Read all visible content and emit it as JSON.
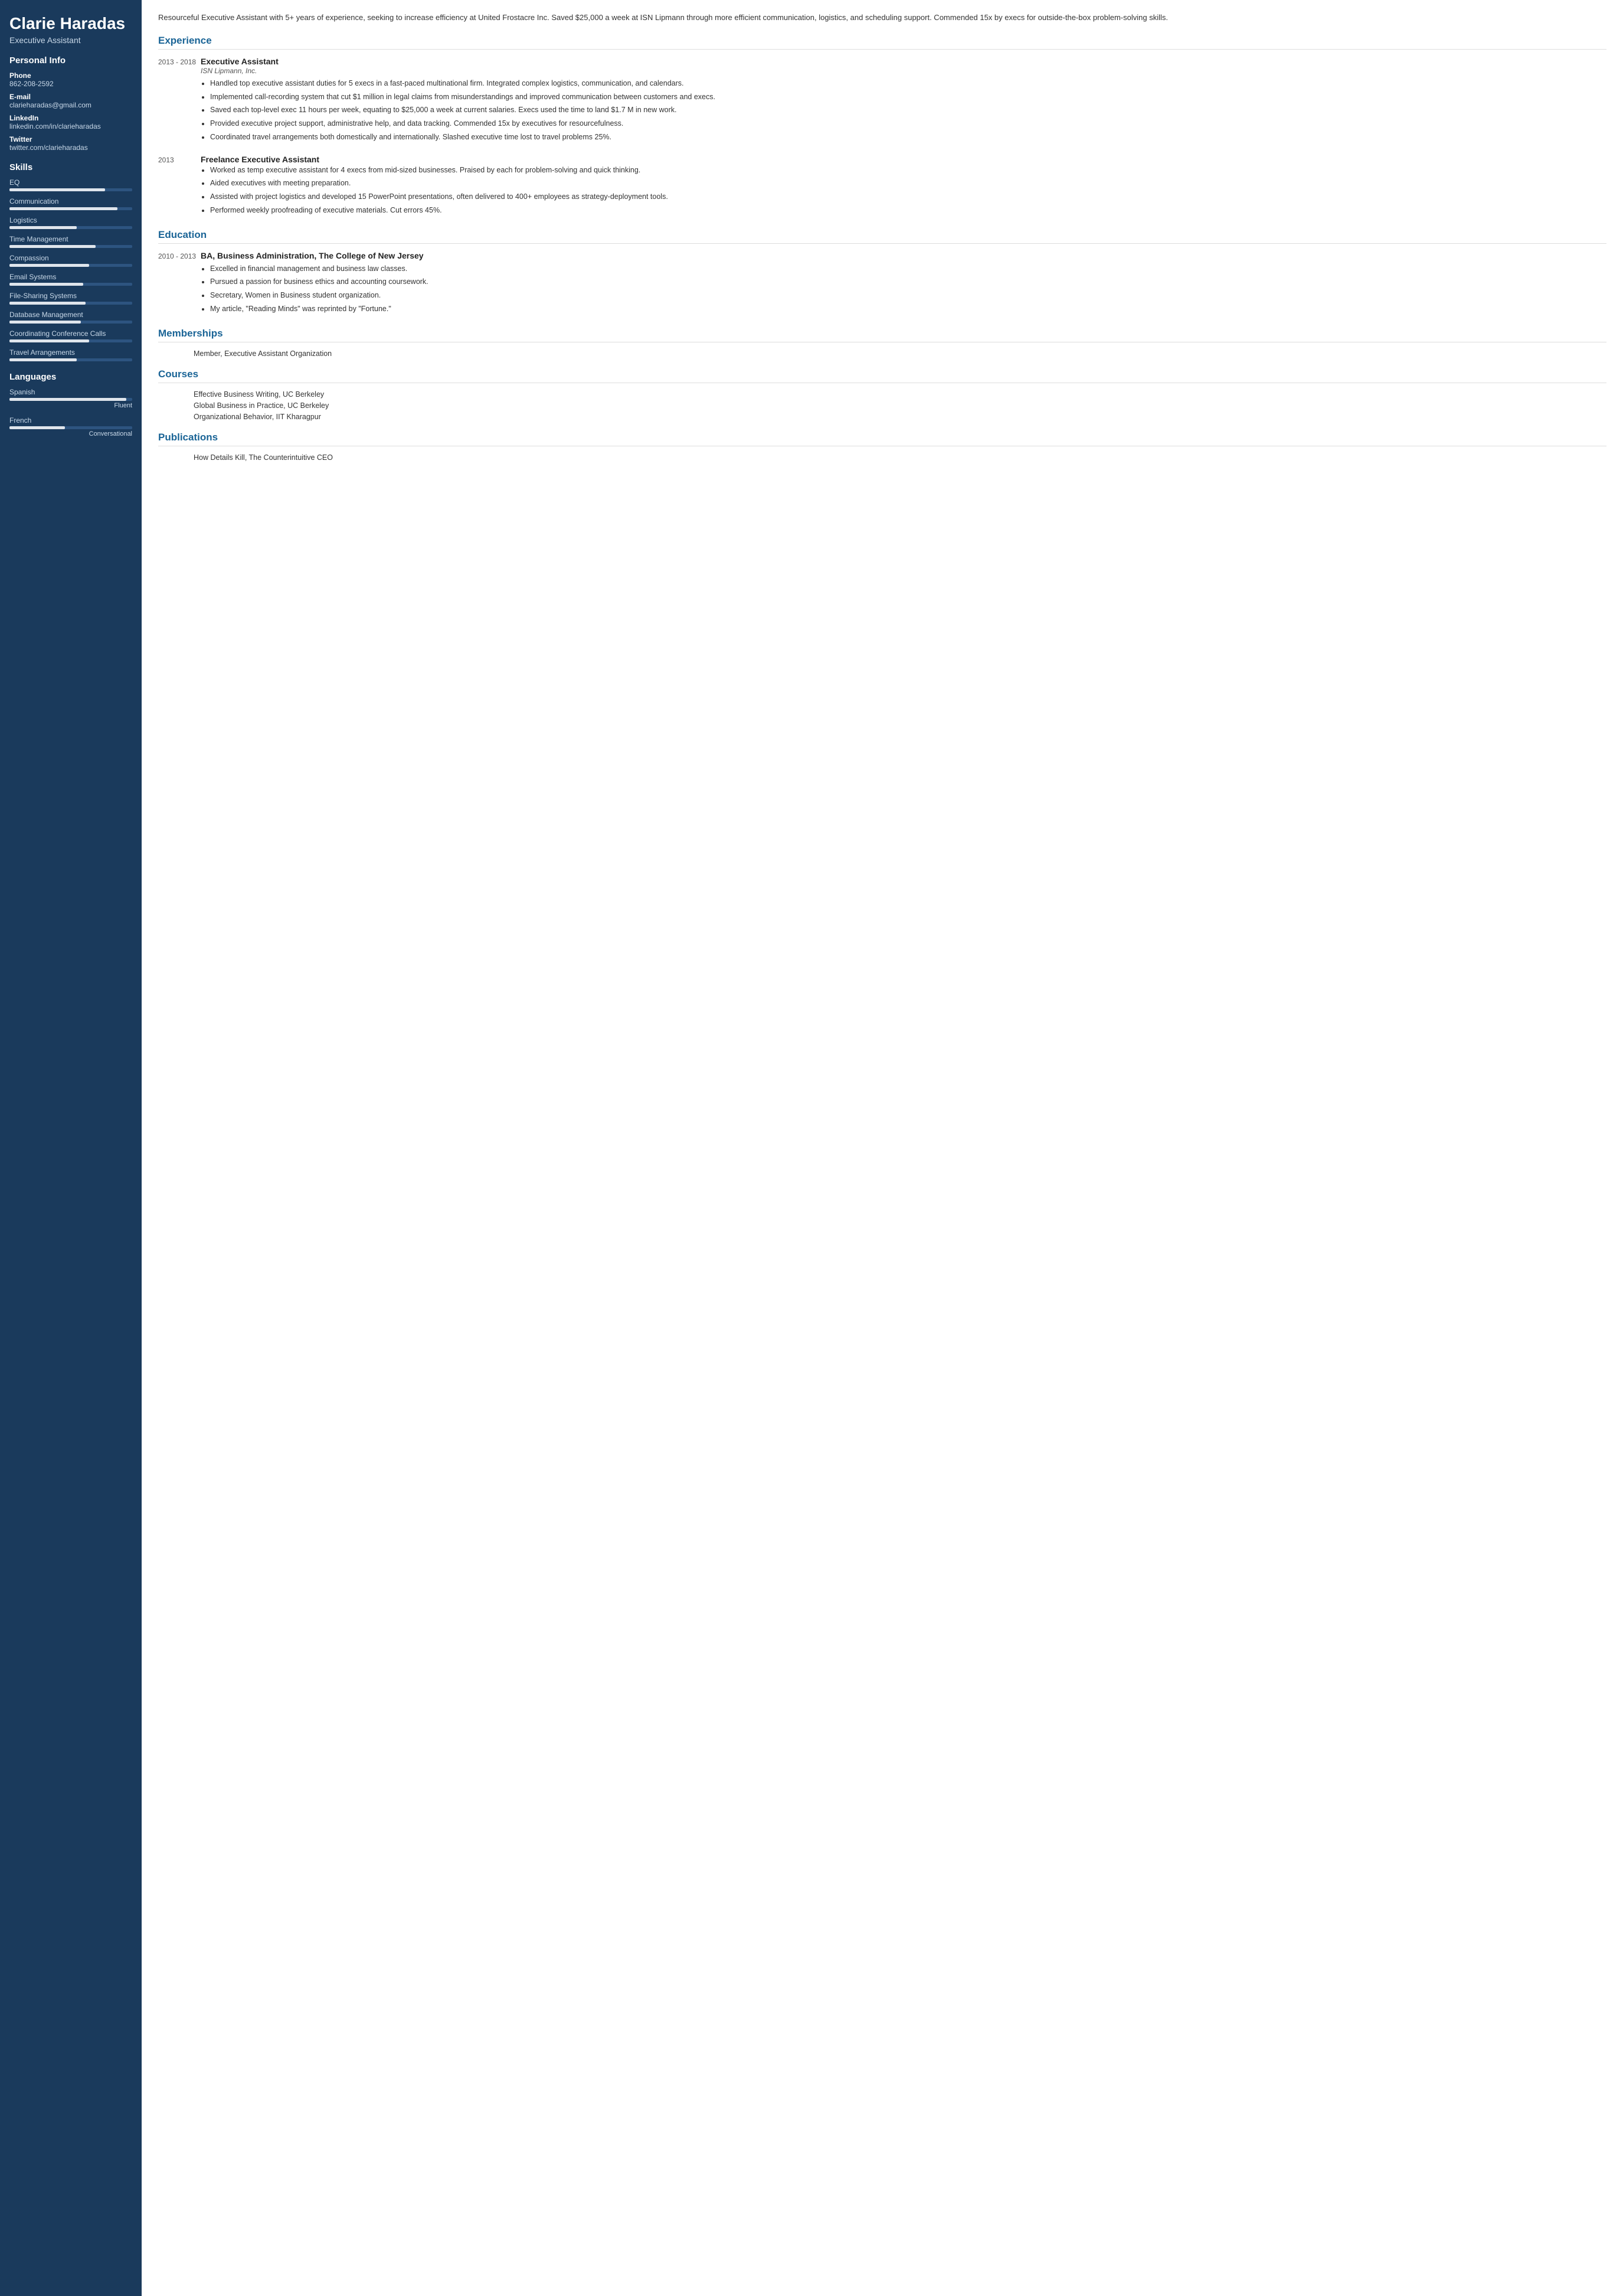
{
  "sidebar": {
    "name": "Clarie Haradas",
    "title": "Executive Assistant",
    "personal_info_section": "Personal Info",
    "phone_label": "Phone",
    "phone_value": "862-208-2592",
    "email_label": "E-mail",
    "email_value": "clarieharadas@gmail.com",
    "linkedin_label": "LinkedIn",
    "linkedin_value": "linkedin.com/in/clarieharadas",
    "twitter_label": "Twitter",
    "twitter_value": "twitter.com/clarieharadas",
    "skills_section": "Skills",
    "skills": [
      {
        "name": "EQ",
        "pct": 78
      },
      {
        "name": "Communication",
        "pct": 88
      },
      {
        "name": "Logistics",
        "pct": 55
      },
      {
        "name": "Time Management",
        "pct": 70
      },
      {
        "name": "Compassion",
        "pct": 65
      },
      {
        "name": "Email Systems",
        "pct": 60
      },
      {
        "name": "File-Sharing Systems",
        "pct": 62
      },
      {
        "name": "Database Management",
        "pct": 58
      },
      {
        "name": "Coordinating Conference Calls",
        "pct": 65
      },
      {
        "name": "Travel Arrangements",
        "pct": 55
      }
    ],
    "languages_section": "Languages",
    "languages": [
      {
        "name": "Spanish",
        "pct": 95,
        "level": "Fluent"
      },
      {
        "name": "French",
        "pct": 45,
        "level": "Conversational"
      }
    ]
  },
  "main": {
    "summary": "Resourceful Executive Assistant with 5+ years of experience, seeking to increase efficiency at United Frostacre Inc. Saved $25,000 a week at ISN Lipmann through more efficient communication, logistics, and scheduling support. Commended 15x by execs for outside-the-box problem-solving skills.",
    "experience_title": "Experience",
    "experience": [
      {
        "dates": "2013 - 2018",
        "job_title": "Executive Assistant",
        "company": "ISN Lipmann, Inc.",
        "bullets": [
          "Handled top executive assistant duties for 5 execs in a fast-paced multinational firm. Integrated complex logistics, communication, and calendars.",
          "Implemented call-recording system that cut $1 million in legal claims from misunderstandings and improved communication between customers and execs.",
          "Saved each top-level exec 11 hours per week, equating to $25,000 a week at current salaries. Execs used the time to land $1.7 M in new work.",
          "Provided executive project support, administrative help, and data tracking. Commended 15x by executives for resourcefulness.",
          "Coordinated travel arrangements both domestically and internationally. Slashed executive time lost to travel problems 25%."
        ]
      },
      {
        "dates": "2013",
        "job_title": "Freelance Executive Assistant",
        "company": "",
        "bullets": [
          "Worked as temp executive assistant for 4 execs from mid-sized businesses. Praised by each for problem-solving and quick thinking.",
          "Aided executives with meeting preparation.",
          "Assisted with project logistics and developed 15 PowerPoint presentations, often delivered to 400+ employees as strategy-deployment tools.",
          "Performed weekly proofreading of executive materials. Cut errors 45%."
        ]
      }
    ],
    "education_title": "Education",
    "education": [
      {
        "dates": "2010 - 2013",
        "degree": "BA, Business Administration, The College of New Jersey",
        "bullets": [
          "Excelled in financial management and business law classes.",
          "Pursued a passion for business ethics and accounting coursework.",
          "Secretary, Women in Business student organization.",
          "My article, \"Reading Minds\" was reprinted by \"Fortune.\""
        ]
      }
    ],
    "memberships_title": "Memberships",
    "memberships": [
      "Member, Executive Assistant Organization"
    ],
    "courses_title": "Courses",
    "courses": [
      "Effective Business Writing, UC Berkeley",
      "Global Business in Practice, UC Berkeley",
      "Organizational Behavior, IIT Kharagpur"
    ],
    "publications_title": "Publications",
    "publications": [
      "How Details Kill, The Counterintuitive CEO"
    ]
  }
}
